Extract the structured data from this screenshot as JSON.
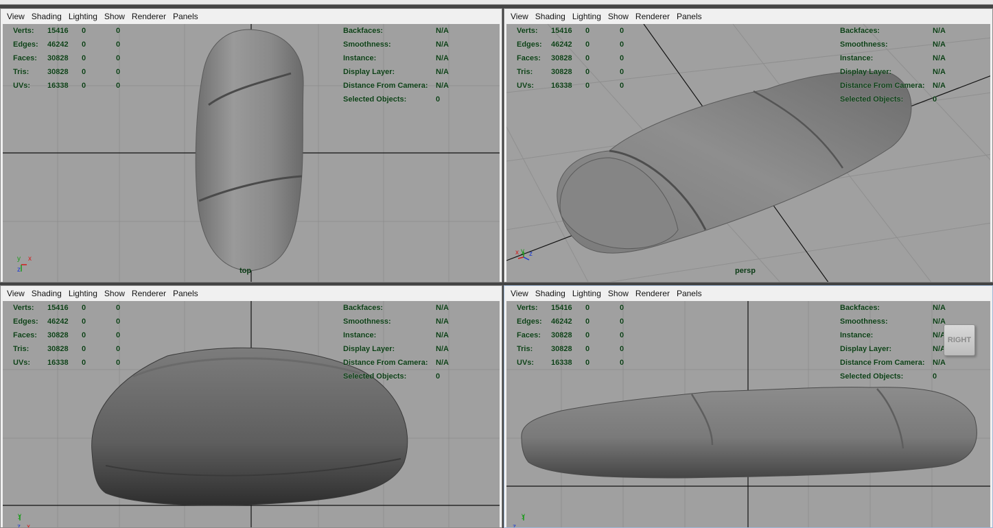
{
  "menu": [
    "View",
    "Shading",
    "Lighting",
    "Show",
    "Renderer",
    "Panels"
  ],
  "stats": [
    {
      "label": "Verts:",
      "v1": "15416",
      "v2": "0",
      "v3": "0"
    },
    {
      "label": "Edges:",
      "v1": "46242",
      "v2": "0",
      "v3": "0"
    },
    {
      "label": "Faces:",
      "v1": "30828",
      "v2": "0",
      "v3": "0"
    },
    {
      "label": "Tris:",
      "v1": "30828",
      "v2": "0",
      "v3": "0"
    },
    {
      "label": "UVs:",
      "v1": "16338",
      "v2": "0",
      "v3": "0"
    }
  ],
  "info": [
    {
      "label": "Backfaces:",
      "value": "N/A"
    },
    {
      "label": "Smoothness:",
      "value": "N/A"
    },
    {
      "label": "Instance:",
      "value": "N/A"
    },
    {
      "label": "Display Layer:",
      "value": "N/A"
    },
    {
      "label": "Distance From Camera:",
      "value": "N/A"
    },
    {
      "label": "Selected Objects:",
      "value": "0"
    }
  ],
  "viewports": {
    "top": {
      "camera": "top"
    },
    "persp": {
      "camera": "persp"
    },
    "front": {
      "camera": ""
    },
    "side": {
      "camera": "",
      "view_cube": "RIGHT"
    }
  },
  "axis_labels": {
    "x": "x",
    "y": "y",
    "z": "z"
  },
  "colors": {
    "hud_text": "#0b3b15",
    "viewport_bg": "#a0a0a0",
    "grid": "#8f8f8f",
    "grid_axis": "#111111"
  }
}
